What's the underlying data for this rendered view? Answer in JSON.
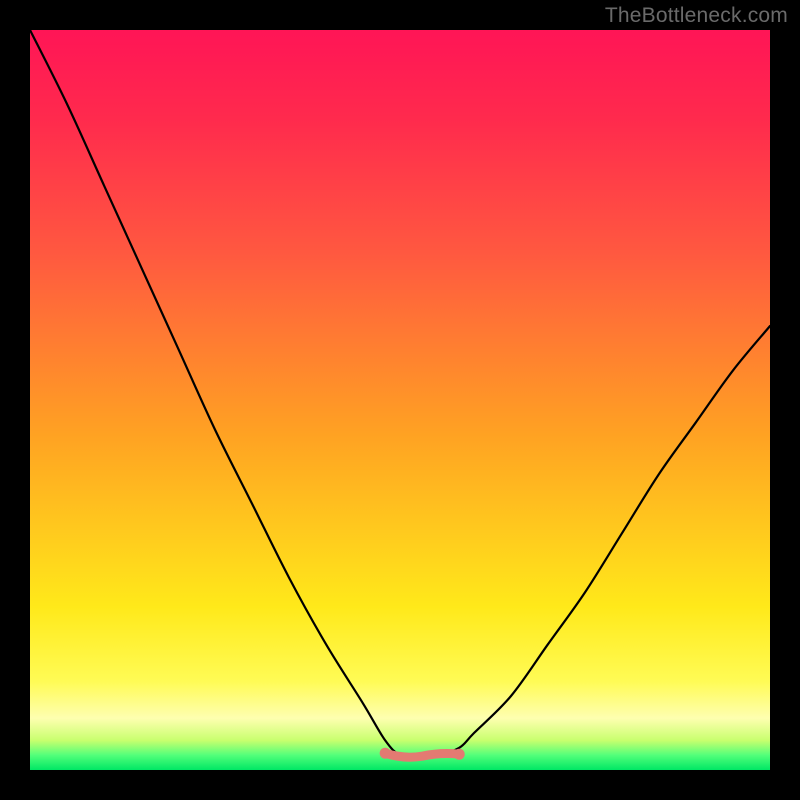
{
  "watermark": "TheBottleneck.com",
  "colors": {
    "frame": "#000000",
    "curve": "#000000",
    "trough_marker": "#e37a72",
    "gradient_top": "#ff1556",
    "gradient_bottom": "#00e765"
  },
  "chart_data": {
    "type": "line",
    "title": "",
    "xlabel": "",
    "ylabel": "",
    "xlim": [
      0,
      100
    ],
    "ylim": [
      0,
      100
    ],
    "x": [
      0,
      5,
      10,
      15,
      20,
      25,
      30,
      35,
      40,
      45,
      48,
      50,
      52,
      55,
      58,
      60,
      65,
      70,
      75,
      80,
      85,
      90,
      95,
      100
    ],
    "values": [
      100,
      90,
      79,
      68,
      57,
      46,
      36,
      26,
      17,
      9,
      4,
      2,
      2,
      2,
      3,
      5,
      10,
      17,
      24,
      32,
      40,
      47,
      54,
      60
    ],
    "trough_range_x": [
      48,
      58
    ],
    "trough_y": 2,
    "annotations": []
  }
}
